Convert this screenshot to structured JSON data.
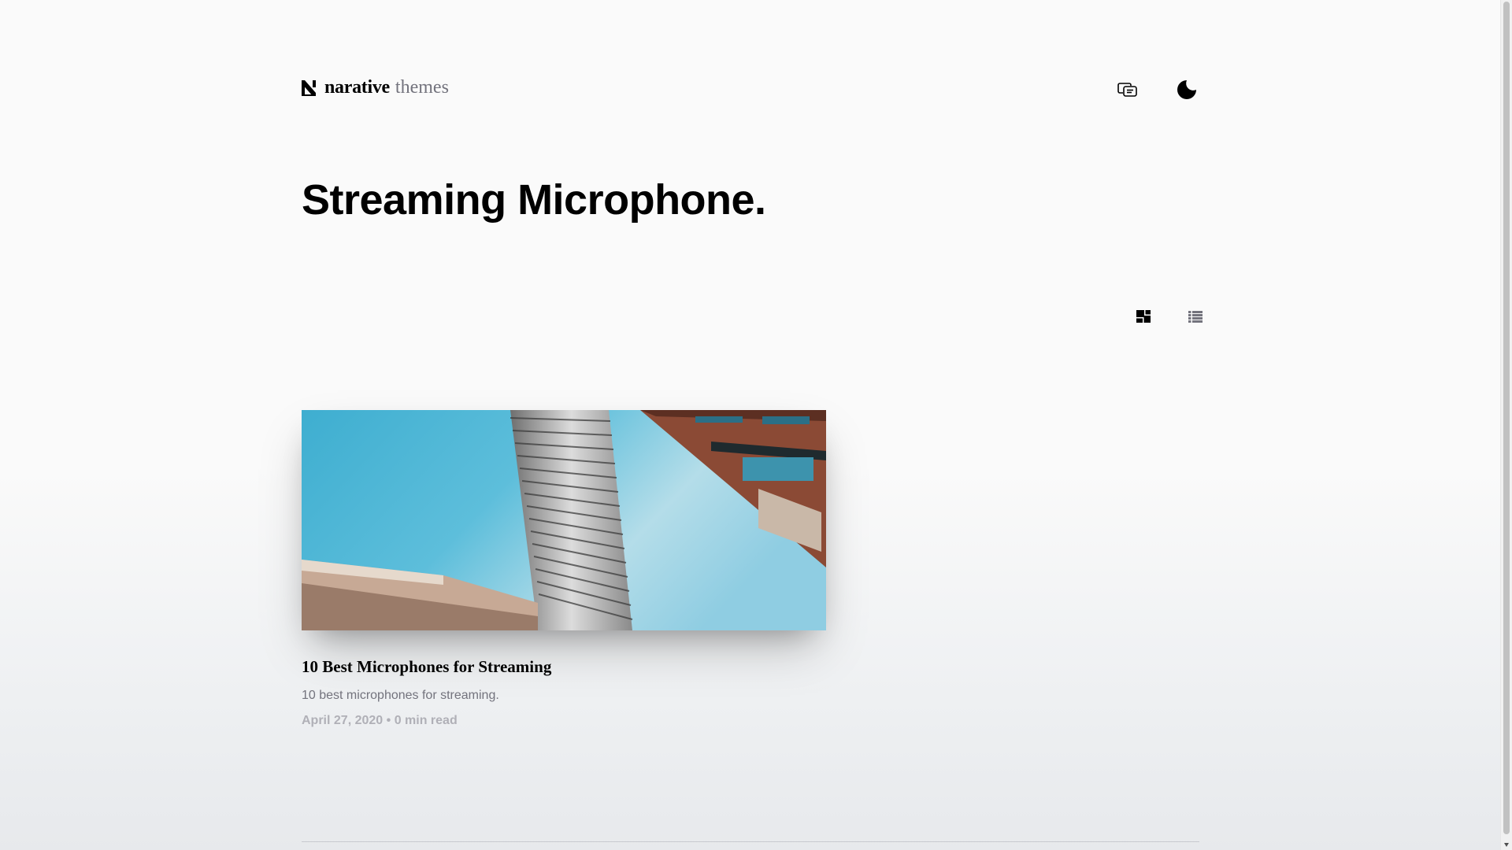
{
  "brand": {
    "name_bold": "narative",
    "name_light": "themes"
  },
  "header": {
    "icons": [
      "share-icon",
      "moon-icon"
    ]
  },
  "page": {
    "title": "Streaming Microphone."
  },
  "layout_toggle": {
    "active": "grid",
    "options": [
      "grid-layout-icon",
      "list-layout-icon"
    ]
  },
  "articles": [
    {
      "title": "10 Best Microphones for Streaming",
      "excerpt": "10 best microphones for streaming.",
      "date": "April 27, 2020",
      "separator": "•",
      "reading_time": "0 min read"
    }
  ],
  "colors": {
    "text": "#000000",
    "muted": "#73737d",
    "meta": "#b0b0b7",
    "sky": "#3fb0d2"
  }
}
